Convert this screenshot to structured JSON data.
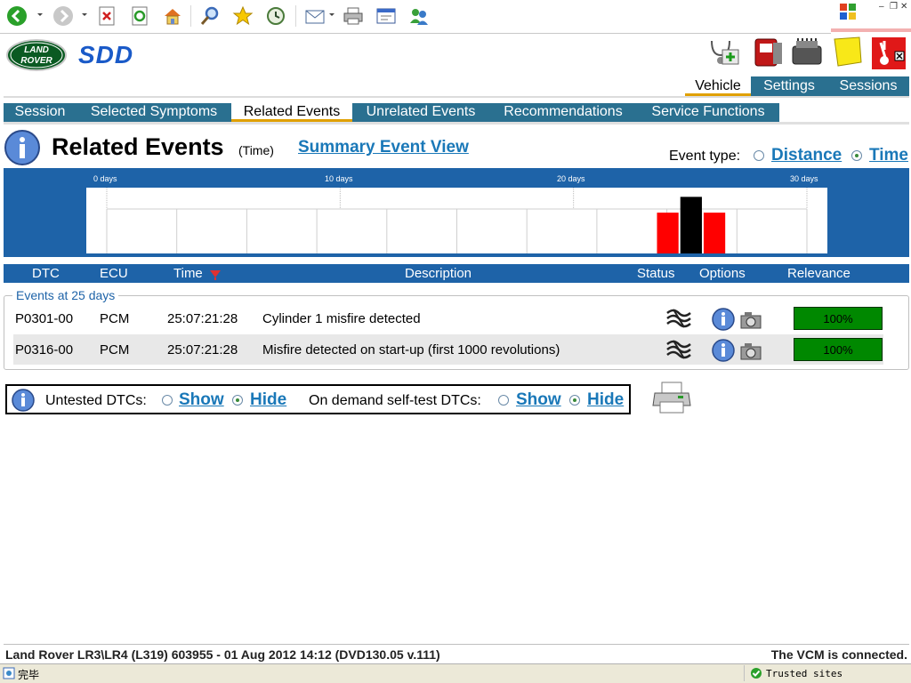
{
  "browser": {
    "status_text": "完毕",
    "zone": "Trusted sites"
  },
  "brand": {
    "logo_line1": "LAND",
    "logo_line2": "ROVER",
    "app_name": "SDD"
  },
  "top_tabs": [
    {
      "label": "Vehicle",
      "active": true
    },
    {
      "label": "Settings",
      "active": false
    },
    {
      "label": "Sessions",
      "active": false
    }
  ],
  "section_tabs": [
    {
      "label": "Session",
      "active": false
    },
    {
      "label": "Selected Symptoms",
      "active": false
    },
    {
      "label": "Related Events",
      "active": true
    },
    {
      "label": "Unrelated Events",
      "active": false
    },
    {
      "label": "Recommendations",
      "active": false
    },
    {
      "label": "Service Functions",
      "active": false
    }
  ],
  "page": {
    "title": "Related Events",
    "title_mode": "(Time)",
    "summary_link": "Summary Event View",
    "event_type_label": "Event type:",
    "event_type_options": [
      {
        "label": "Distance",
        "selected": false
      },
      {
        "label": "Time",
        "selected": true
      }
    ]
  },
  "chart_data": {
    "type": "bar",
    "x_tick_labels": [
      "0 days",
      "10 days",
      "20 days",
      "30 days"
    ],
    "xlim": [
      0,
      30
    ],
    "bars": [
      {
        "day": 24,
        "level": 0.62,
        "color": "#ff0000"
      },
      {
        "day": 25,
        "level": 0.86,
        "color": "#000000"
      },
      {
        "day": 26,
        "level": 0.62,
        "color": "#ff0000"
      }
    ]
  },
  "table": {
    "columns": [
      "DTC",
      "ECU",
      "Time",
      "Description",
      "Status",
      "Options",
      "Relevance"
    ],
    "group_label": "Events at 25 days",
    "rows": [
      {
        "dtc": "P0301-00",
        "ecu": "PCM",
        "time": "25:07:21:28",
        "description": "Cylinder 1 misfire detected",
        "relevance": "100%"
      },
      {
        "dtc": "P0316-00",
        "ecu": "PCM",
        "time": "25:07:21:28",
        "description": "Misfire detected on start-up (first 1000 revolutions)",
        "relevance": "100%"
      }
    ]
  },
  "dtc_filter": {
    "untested_label": "Untested DTCs:",
    "untested_show": "Show",
    "untested_hide": "Hide",
    "untested_selected": "Hide",
    "ondemand_label": "On demand self-test DTCs:",
    "ondemand_show": "Show",
    "ondemand_hide": "Hide",
    "ondemand_selected": "Hide"
  },
  "footer": {
    "vehicle_info": "Land Rover LR3\\LR4 (L319) 603955 - 01 Aug 2012 14:12 (DVD130.05 v.111)",
    "connection": "The VCM is connected."
  }
}
